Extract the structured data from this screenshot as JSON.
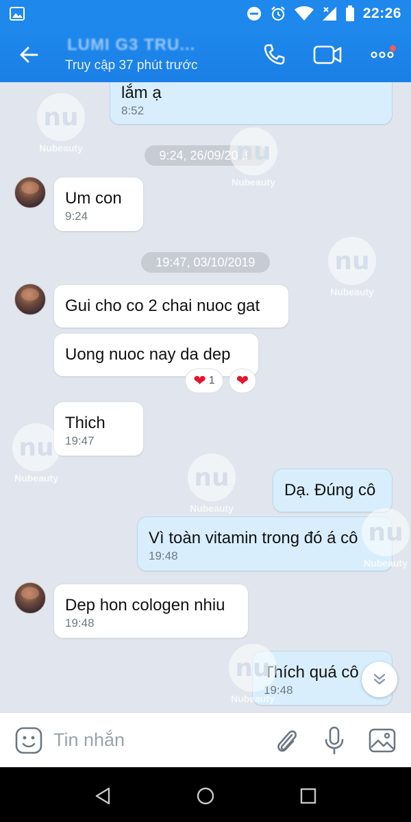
{
  "status_bar": {
    "time": "22:26"
  },
  "header": {
    "contact_name": "LUMI G3 TRU...",
    "contact_status": "Truy cập 37 phút trước"
  },
  "messages": [
    {
      "text": "lắm ạ",
      "time": "8:52"
    },
    {
      "date_divider": "9:24, 26/09/2019"
    },
    {
      "text": "Um con",
      "time": "9:24"
    },
    {
      "date_divider": "19:47, 03/10/2019"
    },
    {
      "text": "Gui cho co 2 chai nuoc gat"
    },
    {
      "text": "Uong nuoc nay da dep",
      "reaction_count": "1"
    },
    {
      "text": "Thich",
      "time": "19:47"
    },
    {
      "text": "Dạ. Đúng cô"
    },
    {
      "text": "Vì toàn vitamin trong đó á cô",
      "time": "19:48"
    },
    {
      "text": "Dep hon cologen nhiu",
      "time": "19:48"
    },
    {
      "text": "Thích quá cô",
      "time": "19:48"
    }
  ],
  "watermark": {
    "logo_text": "nu",
    "label": "Nubeauty"
  },
  "input": {
    "placeholder": "Tin nhắn"
  },
  "colors": {
    "header": "#1e88ec",
    "outgoing_bubble": "#d8eefc",
    "incoming_bubble": "#ffffff",
    "heart": "#e6152b"
  }
}
